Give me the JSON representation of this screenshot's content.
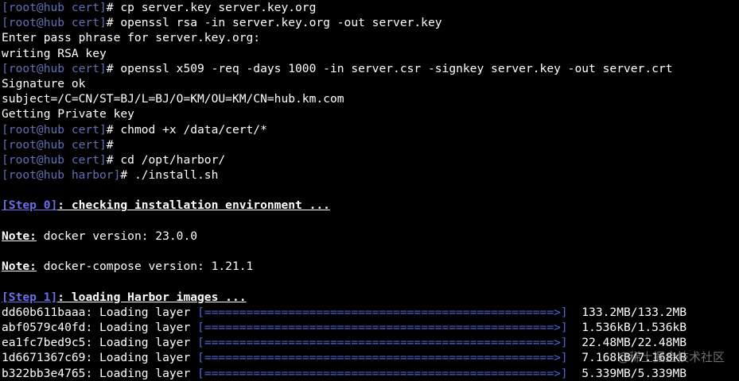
{
  "colors": {
    "background": "#000000",
    "prompt": "#5f6fb4",
    "text": "#ffffff",
    "step_tag": "#6a6ee8",
    "progress_bar": "#4f64d6"
  },
  "terminal": {
    "lines": [
      {
        "kind": "cmd",
        "prompt": "[root@hub cert]",
        "text": "# cp server.key server.key.org"
      },
      {
        "kind": "cmd",
        "prompt": "[root@hub cert]",
        "text": "# openssl rsa -in server.key.org -out server.key"
      },
      {
        "kind": "out",
        "text": "Enter pass phrase for server.key.org:"
      },
      {
        "kind": "out",
        "text": "writing RSA key"
      },
      {
        "kind": "cmd",
        "prompt": "[root@hub cert]",
        "text": "# openssl x509 -req -days 1000 -in server.csr -signkey server.key -out server.crt"
      },
      {
        "kind": "out",
        "text": "Signature ok"
      },
      {
        "kind": "out",
        "text": "subject=/C=CN/ST=BJ/L=BJ/O=KM/OU=KM/CN=hub.km.com"
      },
      {
        "kind": "out",
        "text": "Getting Private key"
      },
      {
        "kind": "cmd",
        "prompt": "[root@hub cert]",
        "text": "# chmod +x /data/cert/*"
      },
      {
        "kind": "cmd",
        "prompt": "[root@hub cert]",
        "text": "#"
      },
      {
        "kind": "cmd",
        "prompt": "[root@hub cert]",
        "text": "# cd /opt/harbor/"
      },
      {
        "kind": "cmd",
        "prompt": "[root@hub harbor]",
        "text": "# ./install.sh"
      },
      {
        "kind": "blank"
      },
      {
        "kind": "step",
        "tag": "[Step 0]",
        "text": ": checking installation environment ..."
      },
      {
        "kind": "blank"
      },
      {
        "kind": "note",
        "tag": "Note:",
        "text": " docker version: 23.0.0"
      },
      {
        "kind": "blank"
      },
      {
        "kind": "note",
        "tag": "Note:",
        "text": " docker-compose version: 1.21.1"
      },
      {
        "kind": "blank"
      },
      {
        "kind": "step",
        "tag": "[Step 1]",
        "text": ": loading Harbor images ..."
      },
      {
        "kind": "layer",
        "id": "dd60b611baaa",
        "label": ": Loading layer ",
        "bar": "[==================================================>]",
        "size": "  133.2MB/133.2MB"
      },
      {
        "kind": "layer",
        "id": "abf0579c40fd",
        "label": ": Loading layer ",
        "bar": "[==================================================>]",
        "size": "  1.536kB/1.536kB"
      },
      {
        "kind": "layer",
        "id": "ea1fc7bed9c5",
        "label": ": Loading layer ",
        "bar": "[==================================================>]",
        "size": "  22.48MB/22.48MB"
      },
      {
        "kind": "layer",
        "id": "1d6671367c69",
        "label": ": Loading layer ",
        "bar": "[==================================================>]",
        "size": "  7.168kB/7.168kB"
      },
      {
        "kind": "layer",
        "id": "b322bb3e4765",
        "label": ": Loading layer ",
        "bar": "[==================================================>]",
        "size": "  5.339MB/5.339MB"
      }
    ]
  },
  "watermark": "@稀土掘金技术社区"
}
